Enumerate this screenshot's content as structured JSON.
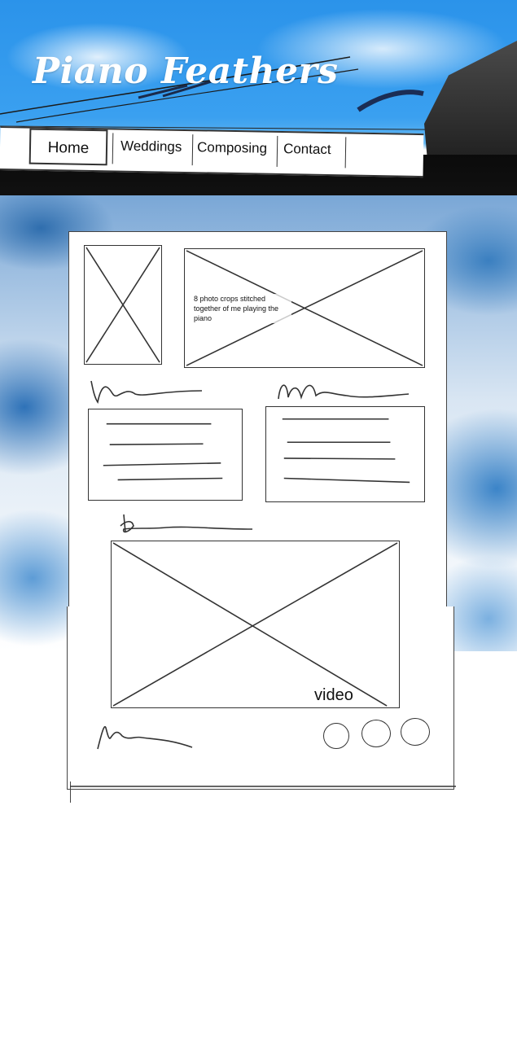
{
  "header": {
    "site_title": "Piano Feathers"
  },
  "nav": {
    "items": [
      {
        "label": "Home",
        "active": true
      },
      {
        "label": "Weddings"
      },
      {
        "label": "Composing"
      },
      {
        "label": "Contact"
      }
    ]
  },
  "content": {
    "photo_note": "8 photo crops stitched together of me playing the piano",
    "video_label": "video"
  },
  "colors": {
    "sky": "#2b93ea",
    "band": "#0b0b0b",
    "ink": "#333333"
  },
  "icons": {
    "placeholder_image": "crossed-box",
    "social_links": [
      "circle",
      "circle",
      "circle"
    ]
  }
}
